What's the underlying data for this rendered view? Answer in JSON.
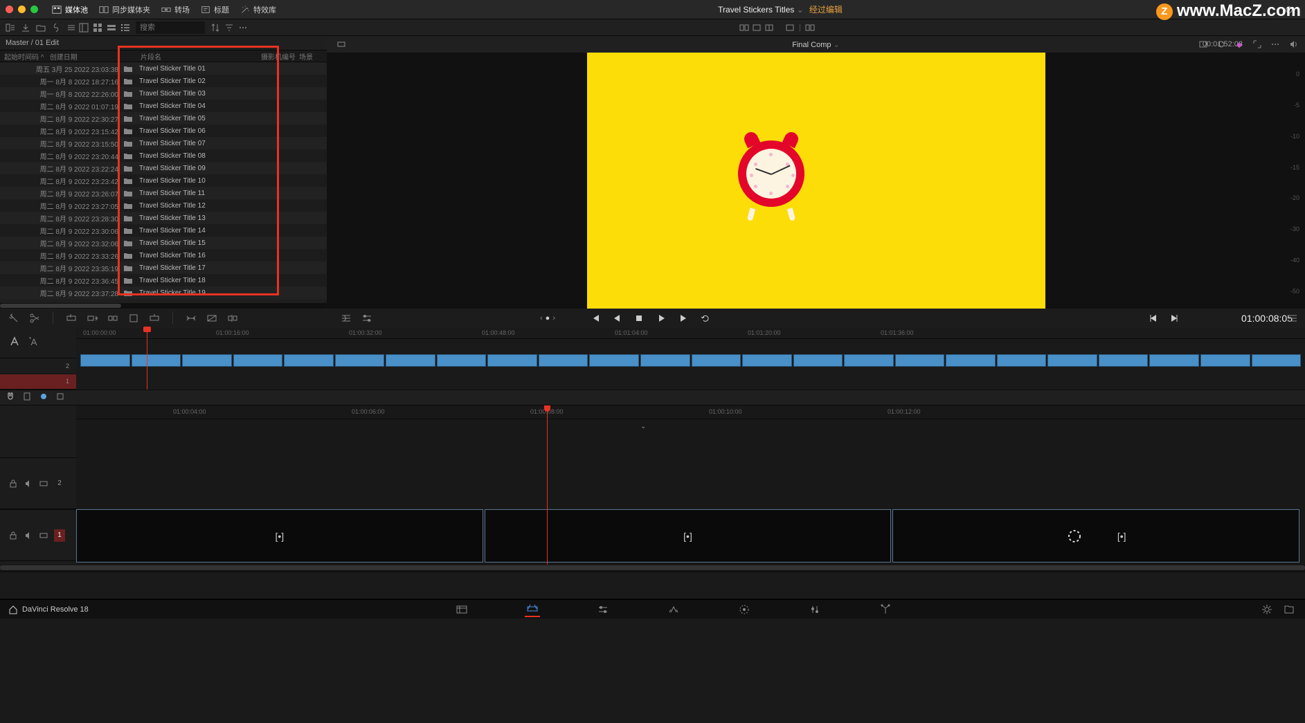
{
  "watermark": "www.MacZ.com",
  "top": {
    "media_pool": "媒体池",
    "sync_bin": "同步媒体夹",
    "transitions": "转场",
    "titles": "标题",
    "effects": "特效库",
    "project": "Travel Stickers Titles",
    "status": "经过编辑"
  },
  "viewer": {
    "title": "Final Comp",
    "tc_left": "00:01:52:03",
    "tc_right": "01:00:08:05",
    "db": [
      "0",
      "-5",
      "-10",
      "-15",
      "-20",
      "-30",
      "-40",
      "-50"
    ]
  },
  "sec": {
    "search_ph": "搜索"
  },
  "media": {
    "breadcrumb": "Master / 01 Edit",
    "cols": {
      "col1": "起始时间码",
      "col2": "创建日期",
      "name": "片段名",
      "cam": "摄影机编号",
      "scene": "场景"
    },
    "rows": [
      {
        "date": "周五 3月 25 2022 23:03:38",
        "name": "Travel Sticker Title 01"
      },
      {
        "date": "周一 8月 8 2022 18:27:16",
        "name": "Travel Sticker Title 02"
      },
      {
        "date": "周一 8月 8 2022 22:26:00",
        "name": "Travel Sticker Title 03"
      },
      {
        "date": "周二 8月 9 2022 01:07:19",
        "name": "Travel Sticker Title 04"
      },
      {
        "date": "周二 8月 9 2022 22:30:27",
        "name": "Travel Sticker Title 05"
      },
      {
        "date": "周二 8月 9 2022 23:15:42",
        "name": "Travel Sticker Title 06"
      },
      {
        "date": "周二 8月 9 2022 23:15:50",
        "name": "Travel Sticker Title 07"
      },
      {
        "date": "周二 8月 9 2022 23:20:44",
        "name": "Travel Sticker Title 08"
      },
      {
        "date": "周二 8月 9 2022 23:22:24",
        "name": "Travel Sticker Title 09"
      },
      {
        "date": "周二 8月 9 2022 23:23:42",
        "name": "Travel Sticker Title 10"
      },
      {
        "date": "周二 8月 9 2022 23:26:07",
        "name": "Travel Sticker Title 11"
      },
      {
        "date": "周二 8月 9 2022 23:27:05",
        "name": "Travel Sticker Title 12"
      },
      {
        "date": "周二 8月 9 2022 23:28:30",
        "name": "Travel Sticker Title 13"
      },
      {
        "date": "周二 8月 9 2022 23:30:06",
        "name": "Travel Sticker Title 14"
      },
      {
        "date": "周二 8月 9 2022 23:32:06",
        "name": "Travel Sticker Title 15"
      },
      {
        "date": "周二 8月 9 2022 23:33:26",
        "name": "Travel Sticker Title 16"
      },
      {
        "date": "周二 8月 9 2022 23:35:19",
        "name": "Travel Sticker Title 17"
      },
      {
        "date": "周二 8月 9 2022 23:36:45",
        "name": "Travel Sticker Title 18"
      },
      {
        "date": "周二 8月 9 2022 23:37:28",
        "name": "Travel Sticker Title 19"
      }
    ]
  },
  "ut": {
    "ticks": [
      "01:00:00:00",
      "01:00:16:00",
      "01:00:32:00",
      "01:00:48:00",
      "01:01:04:00",
      "01:01:20:00",
      "01:01:36:00"
    ],
    "trk2": "2",
    "trk1": "1"
  },
  "lt": {
    "ticks": [
      "01:00:04:00",
      "01:00:06:00",
      "01:00:08:00",
      "01:00:10:00",
      "01:00:12:00"
    ],
    "trk2": "2",
    "trk1": "1",
    "zoom": "⌄"
  },
  "footer": {
    "label": "DaVinci Resolve 18"
  }
}
